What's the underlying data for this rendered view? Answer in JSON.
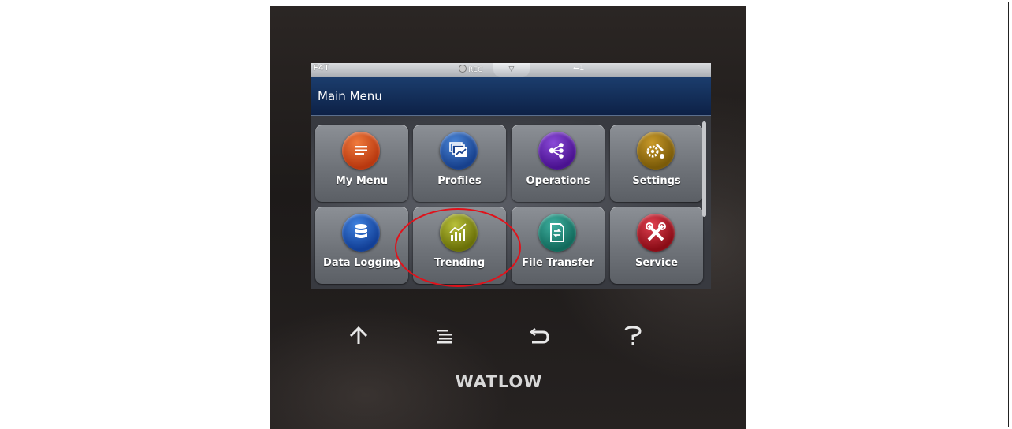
{
  "statusbar": {
    "model": "F4T",
    "rec_label": "REC",
    "tab_glyph": "▽",
    "usb_label": "1"
  },
  "header": {
    "title": "Main Menu"
  },
  "tiles": [
    {
      "label": "My Menu",
      "icon": "list-icon",
      "color": "#c6451a"
    },
    {
      "label": "Profiles",
      "icon": "profiles-icon",
      "color": "#1f4fa0"
    },
    {
      "label": "Operations",
      "icon": "share-icon",
      "color": "#5b1aa6"
    },
    {
      "label": "Settings",
      "icon": "gears-icon",
      "color": "#8a6a10"
    },
    {
      "label": "Data Logging",
      "icon": "database-icon",
      "color": "#1d5bb0"
    },
    {
      "label": "Trending",
      "icon": "chart-icon",
      "color": "#868f12"
    },
    {
      "label": "File Transfer",
      "icon": "file-transfer-icon",
      "color": "#1f7a6c"
    },
    {
      "label": "Service",
      "icon": "tools-icon",
      "color": "#a8141f"
    }
  ],
  "navkeys": [
    {
      "name": "home-key-icon"
    },
    {
      "name": "menu-key-icon"
    },
    {
      "name": "back-key-icon"
    },
    {
      "name": "help-key-icon"
    }
  ],
  "brand": "WATLOW",
  "annotation": {
    "highlight_color": "#e0121b"
  }
}
